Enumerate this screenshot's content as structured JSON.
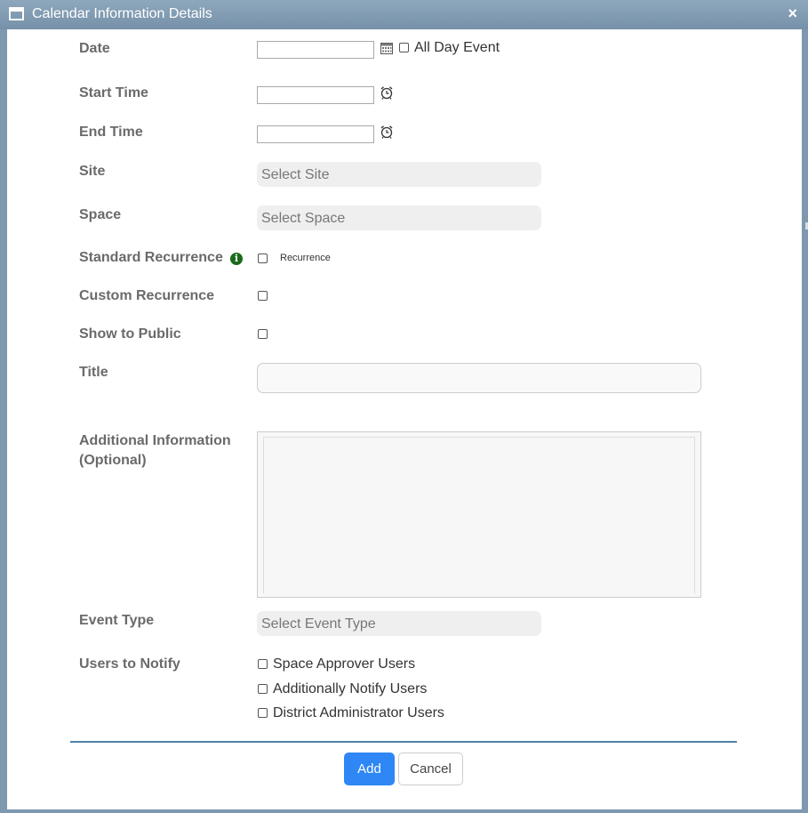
{
  "window": {
    "title": "Calendar Information Details",
    "close_symbol": "×"
  },
  "form": {
    "date": {
      "label": "Date",
      "value": "",
      "all_day_label": "All Day Event",
      "all_day_checked": false
    },
    "start_time": {
      "label": "Start Time",
      "value": ""
    },
    "end_time": {
      "label": "End Time",
      "value": ""
    },
    "site": {
      "label": "Site",
      "placeholder": "Select Site"
    },
    "space": {
      "label": "Space",
      "placeholder": "Select Space"
    },
    "standard_recurrence": {
      "label": "Standard Recurrence",
      "option_label": "Recurrence",
      "checked": false
    },
    "custom_recurrence": {
      "label": "Custom Recurrence",
      "checked": false
    },
    "show_to_public": {
      "label": "Show to Public",
      "checked": false
    },
    "title": {
      "label": "Title",
      "value": ""
    },
    "additional_info": {
      "label_line1": "Additional Information",
      "label_line2": "(Optional)",
      "value": ""
    },
    "event_type": {
      "label": "Event Type",
      "placeholder": "Select Event Type"
    },
    "users_to_notify": {
      "label": "Users to Notify",
      "options": [
        {
          "label": "Space Approver Users",
          "checked": false
        },
        {
          "label": "Additionally Notify Users",
          "checked": false
        },
        {
          "label": "District Administrator Users",
          "checked": false
        }
      ]
    }
  },
  "buttons": {
    "add": "Add",
    "cancel": "Cancel"
  },
  "icons": {
    "calendar": "calendar-icon",
    "clock": "alarm-clock-icon",
    "info": "info-icon"
  },
  "colors": {
    "titlebar": "#7d98af",
    "label": "#6a6a6a",
    "primary_button": "#2f87f5",
    "divider": "#4f81a8",
    "info_icon": "#1a6b1a"
  }
}
